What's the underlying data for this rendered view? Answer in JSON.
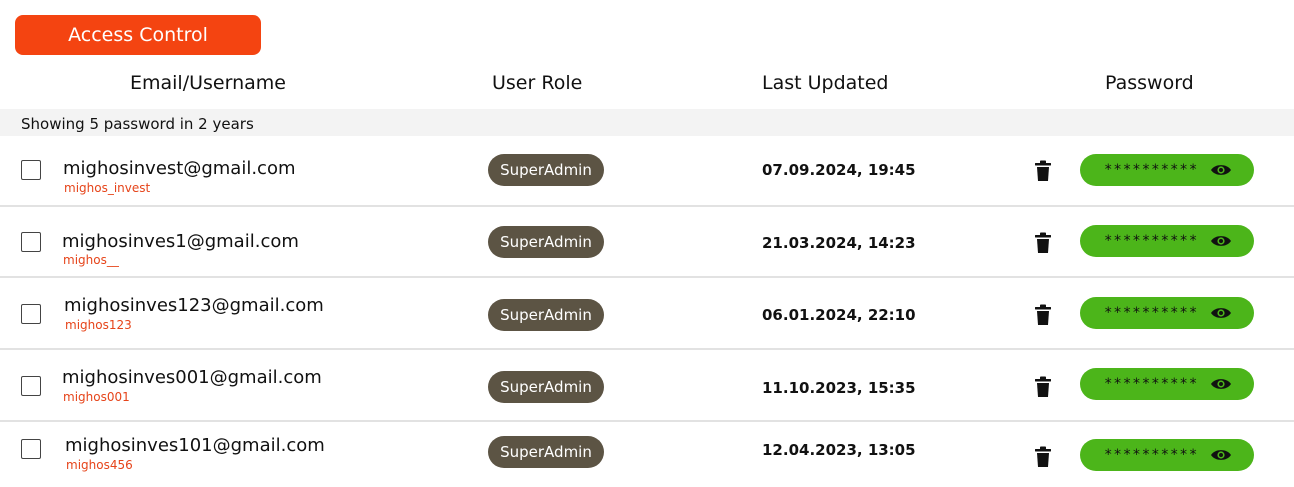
{
  "header": {
    "access_control_label": "Access Control"
  },
  "columns": {
    "email": "Email/Username",
    "role": "User Role",
    "updated": "Last Updated",
    "password": "Password"
  },
  "summary": "Showing 5 password in 2 years",
  "rows": [
    {
      "email": "mighosinvest@gmail.com",
      "username": "mighos_invest",
      "role": "SuperAdmin",
      "updated": "07.09.2024, 19:45",
      "password_mask": "**********"
    },
    {
      "email": "mighosinves1@gmail.com",
      "username": "mighos__",
      "role": "SuperAdmin",
      "updated": "21.03.2024, 14:23",
      "password_mask": "**********"
    },
    {
      "email": "mighosinves123@gmail.com",
      "username": "mighos123",
      "role": "SuperAdmin",
      "updated": "06.01.2024, 22:10",
      "password_mask": "**********"
    },
    {
      "email": "mighosinves001@gmail.com",
      "username": "mighos001",
      "role": "SuperAdmin",
      "updated": "11.10.2023, 15:35",
      "password_mask": "**********"
    },
    {
      "email": "mighosinves101@gmail.com",
      "username": "mighos456",
      "role": "SuperAdmin",
      "updated": "12.04.2023, 13:05",
      "password_mask": "**********"
    }
  ],
  "colors": {
    "accent": "#f44411",
    "username": "#e6441a",
    "role_badge": "#5c5444",
    "password_pill": "#4cb51a"
  },
  "icons": {
    "delete": "trash-icon",
    "reveal": "eye-icon"
  }
}
